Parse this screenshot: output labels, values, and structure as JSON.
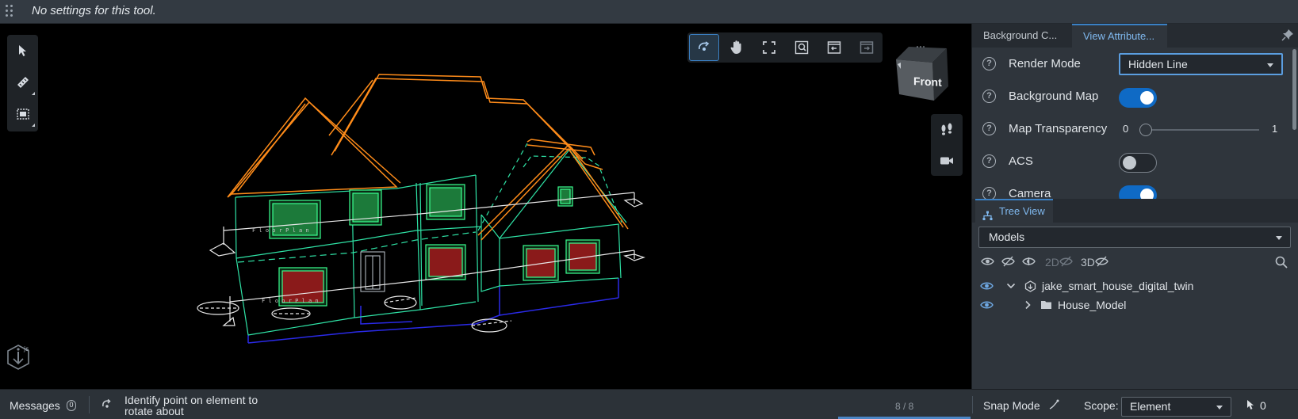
{
  "toolsettings": {
    "message": "No settings for this tool."
  },
  "viewport": {
    "view_cube_label": "Front",
    "nav_tools": [
      "rotate",
      "pan",
      "fit-view",
      "zoom-window",
      "window-area",
      "toggle-camera"
    ],
    "annotation_text": "F l o o r  P l a n"
  },
  "panel": {
    "tabs": [
      "Background C...",
      "View Attribute..."
    ],
    "properties": {
      "render_mode": {
        "label": "Render Mode",
        "value": "Hidden Line"
      },
      "background_map": {
        "label": "Background Map",
        "on": true
      },
      "map_transparency": {
        "label": "Map Transparency",
        "min": "0",
        "max": "1",
        "value": 0
      },
      "acs": {
        "label": "ACS",
        "on": false
      },
      "camera": {
        "label": "Camera",
        "on": true
      }
    },
    "tree": {
      "tab_label": "Tree View",
      "dropdown": "Models",
      "tools": {
        "two_d": "2D",
        "three_d": "3D"
      },
      "items": [
        {
          "label": "jake_smart_house_digital_twin",
          "expanded": true
        },
        {
          "label": "House_Model",
          "expanded": false
        }
      ]
    }
  },
  "statusbar": {
    "messages_label": "Messages",
    "messages_count": "0",
    "prompt": "Identify point on element to rotate about",
    "frame_count": "8 / 8",
    "snap_label": "Snap Mode",
    "scope_label": "Scope:",
    "scope_value": "Element",
    "selection_count": "0"
  },
  "colors": {
    "accent": "#3a80c4",
    "toggle_on": "#0f6ac5",
    "roof": "#ff8c1a",
    "walls": "#2fe3a6",
    "foundation": "#2a2ae8",
    "windows": "#1c7a3a",
    "windows_lower": "#8a1a1a"
  }
}
